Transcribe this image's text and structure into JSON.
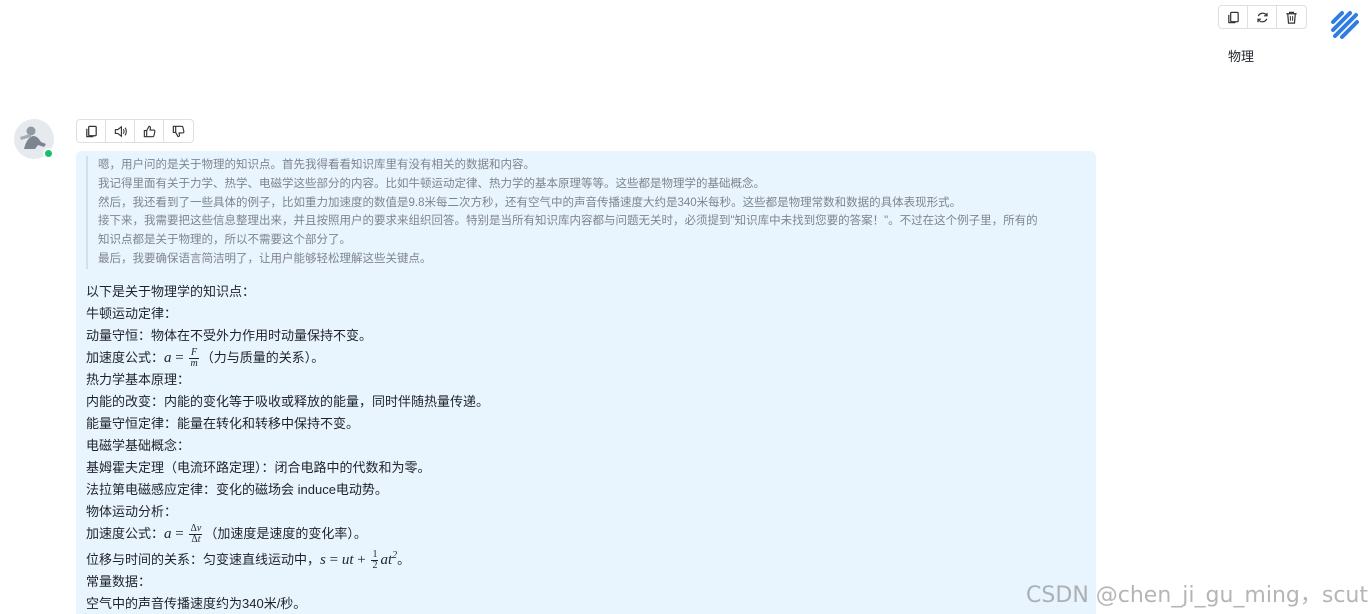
{
  "user_message": {
    "text": "物理",
    "toolbar": {
      "icons": [
        "copy-icon",
        "refresh-icon",
        "trash-icon"
      ]
    }
  },
  "bot_message": {
    "toolbar": {
      "icons": [
        "copy-icon",
        "speaker-icon",
        "thumbs-up-icon",
        "thumbs-down-icon"
      ]
    },
    "thinking": [
      "嗯，用户问的是关于物理的知识点。首先我得看看知识库里有没有相关的数据和内容。",
      "我记得里面有关于力学、热学、电磁学这些部分的内容。比如牛顿运动定律、热力学的基本原理等等。这些都是物理学的基础概念。",
      "然后，我还看到了一些具体的例子，比如重力加速度的数值是9.8米每二次方秒，还有空气中的声音传播速度大约是340米每秒。这些都是物理常数和数据的具体表现形式。",
      "接下来，我需要把这些信息整理出来，并且按照用户的要求来组织回答。特别是当所有知识库内容都与问题无关时，必须提到\"知识库中未找到您要的答案！\"。不过在这个例子里，所有的",
      "知识点都是关于物理的，所以不需要这个部分了。",
      "最后，我要确保语言简洁明了，让用户能够轻松理解这些关键点。"
    ],
    "answer": {
      "intro": "以下是关于物理学的知识点：",
      "newton_heading": "牛顿运动定律：",
      "momentum": "动量守恒：物体在不受外力作用时动量保持不变。",
      "accel_prefix": "加速度公式：",
      "accel_suffix": "（力与质量的关系）。",
      "thermo_heading": "热力学基本原理：",
      "internal_energy": "内能的改变：内能的变化等于吸收或释放的能量，同时伴随热量传递。",
      "energy_conservation": "能量守恒定律：能量在转化和转移中保持不变。",
      "em_heading": "电磁学基础概念：",
      "kirchhoff": "基姆霍夫定理（电流环路定理）：闭合电路中的代数和为零。",
      "faraday": "法拉第电磁感应定律：变化的磁场会 induce电动势。",
      "motion_heading": "物体运动分析：",
      "accel2_prefix": "加速度公式：",
      "accel2_suffix": "（加速度是速度的变化率）。",
      "displacement_prefix": "位移与时间的关系：匀变速直线运动中，",
      "displacement_suffix": "。",
      "constants_heading": "常量数据：",
      "sound_speed": "空气中的声音传播速度约为340米/秒。"
    }
  },
  "watermark": "CSDN @chen_ji_gu_ming，scut"
}
